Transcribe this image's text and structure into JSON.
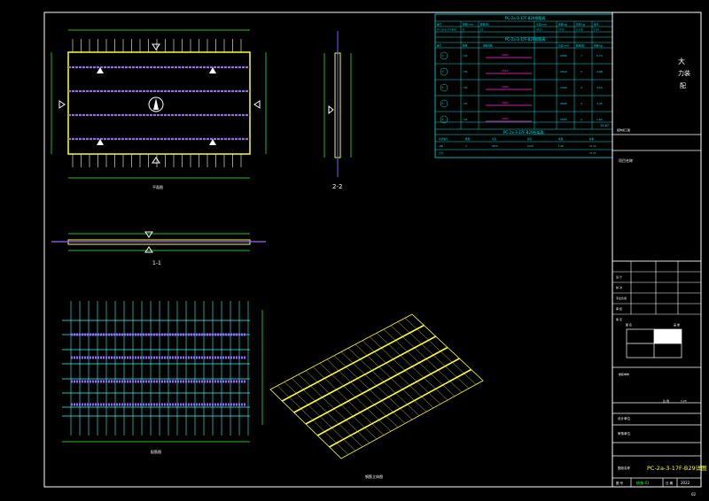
{
  "colors": {
    "background": "#000000",
    "frame": "#ffffff",
    "dimension": "#33ff33",
    "rebar_main": "#ffff33",
    "rebar_dist": "#6666ff",
    "table": "#00e0e0",
    "highlight": "#ff33cc",
    "truss": "#9966ff"
  },
  "views": {
    "plan_label": "平面图",
    "side_label": "2-2",
    "elev_label": "1-1",
    "rebar_label": "配筋图",
    "iso_label": "钢筋立体图"
  },
  "table": {
    "title": "PC-2a-3-17F-B29钢筋表",
    "header": [
      "编号",
      "规格(mm)",
      "数量(根)",
      "长度(mm)",
      "重量(kg)",
      "总重(kg)",
      "备注"
    ],
    "summary_row": [
      "PC-2a-3-17F-B29",
      "8",
      "15",
      "3020",
      "2710",
      "0.156",
      "5.94"
    ],
    "subtitle": "PC-2a-3-17F-B29钢筋表",
    "sub_header": [
      "编号",
      "规格",
      "钢筋简图",
      "长度(mm)",
      "数量(根)",
      "重量(kg)"
    ],
    "rows": [
      {
        "id": "①",
        "spec": "C8",
        "len": "2050",
        "qty": "7",
        "wt": "5.73"
      },
      {
        "id": "②",
        "spec": "C8",
        "len": "2510",
        "qty": "5",
        "wt": "4.96"
      },
      {
        "id": "③",
        "spec": "C8",
        "len": "1990",
        "qty": "4",
        "wt": "3.14"
      },
      {
        "id": "④",
        "spec": "C8",
        "len": "2800",
        "qty": "4",
        "wt": "4.42"
      },
      {
        "id": "⑤",
        "spec": "C8",
        "len": "2050",
        "qty": "2",
        "wt": "1.62"
      }
    ],
    "total": "19.87",
    "truss_title": "PC-2a-3-17F-B29桁架表",
    "truss_header": [
      "桁架编号",
      "数量",
      "长度",
      "总长",
      "重量",
      "总重"
    ],
    "truss_rows": [
      [
        "A80",
        "3",
        "2050",
        "6150",
        "1.98",
        "12.18"
      ],
      [
        "合计",
        "",
        "",
        "",
        "",
        "12.18"
      ]
    ]
  },
  "title_block": {
    "company_line1": "大",
    "company_line2": "力装",
    "company_line3": "配",
    "project_label": "项目名称",
    "building_label": "楼栋单体",
    "stamp_label": "图 名",
    "seal_label": "盖 章",
    "rows_left": [
      "设 计",
      "校 对",
      "专业负责",
      "审 核",
      "审 定"
    ],
    "scale_label": "比 例",
    "scale_value": "1:25",
    "designer_label": "设计单位",
    "checker_label": "审核单位",
    "drawing_name_label": "图纸名称",
    "drawing_name": "PC-2a-3-17F-B29详图",
    "date_label": "日 期",
    "date_value": "2022",
    "drawing_no_label": "图 号",
    "drawing_no": "结施-01",
    "page_no": "02",
    "note_text": "结构施工图"
  }
}
